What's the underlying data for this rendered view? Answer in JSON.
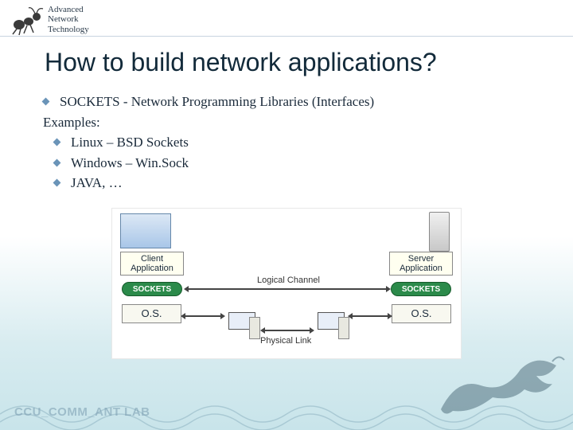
{
  "header": {
    "line1": "Advanced",
    "line2": "Network",
    "line3": "Technology"
  },
  "title": "How to build network applications?",
  "body": {
    "main_bullet": "SOCKETS - Network Programming Libraries (Interfaces)",
    "examples_label": "Examples:",
    "examples": [
      "Linux – BSD Sockets",
      "Windows – Win.Sock",
      "JAVA, …"
    ]
  },
  "diagram": {
    "client_app": "Client\nApplication",
    "server_app": "Server\nApplication",
    "sockets": "SOCKETS",
    "os": "O.S.",
    "logical": "Logical Channel",
    "physical": "Physical Link"
  },
  "footer": "CCU_COMM_ANT LAB"
}
